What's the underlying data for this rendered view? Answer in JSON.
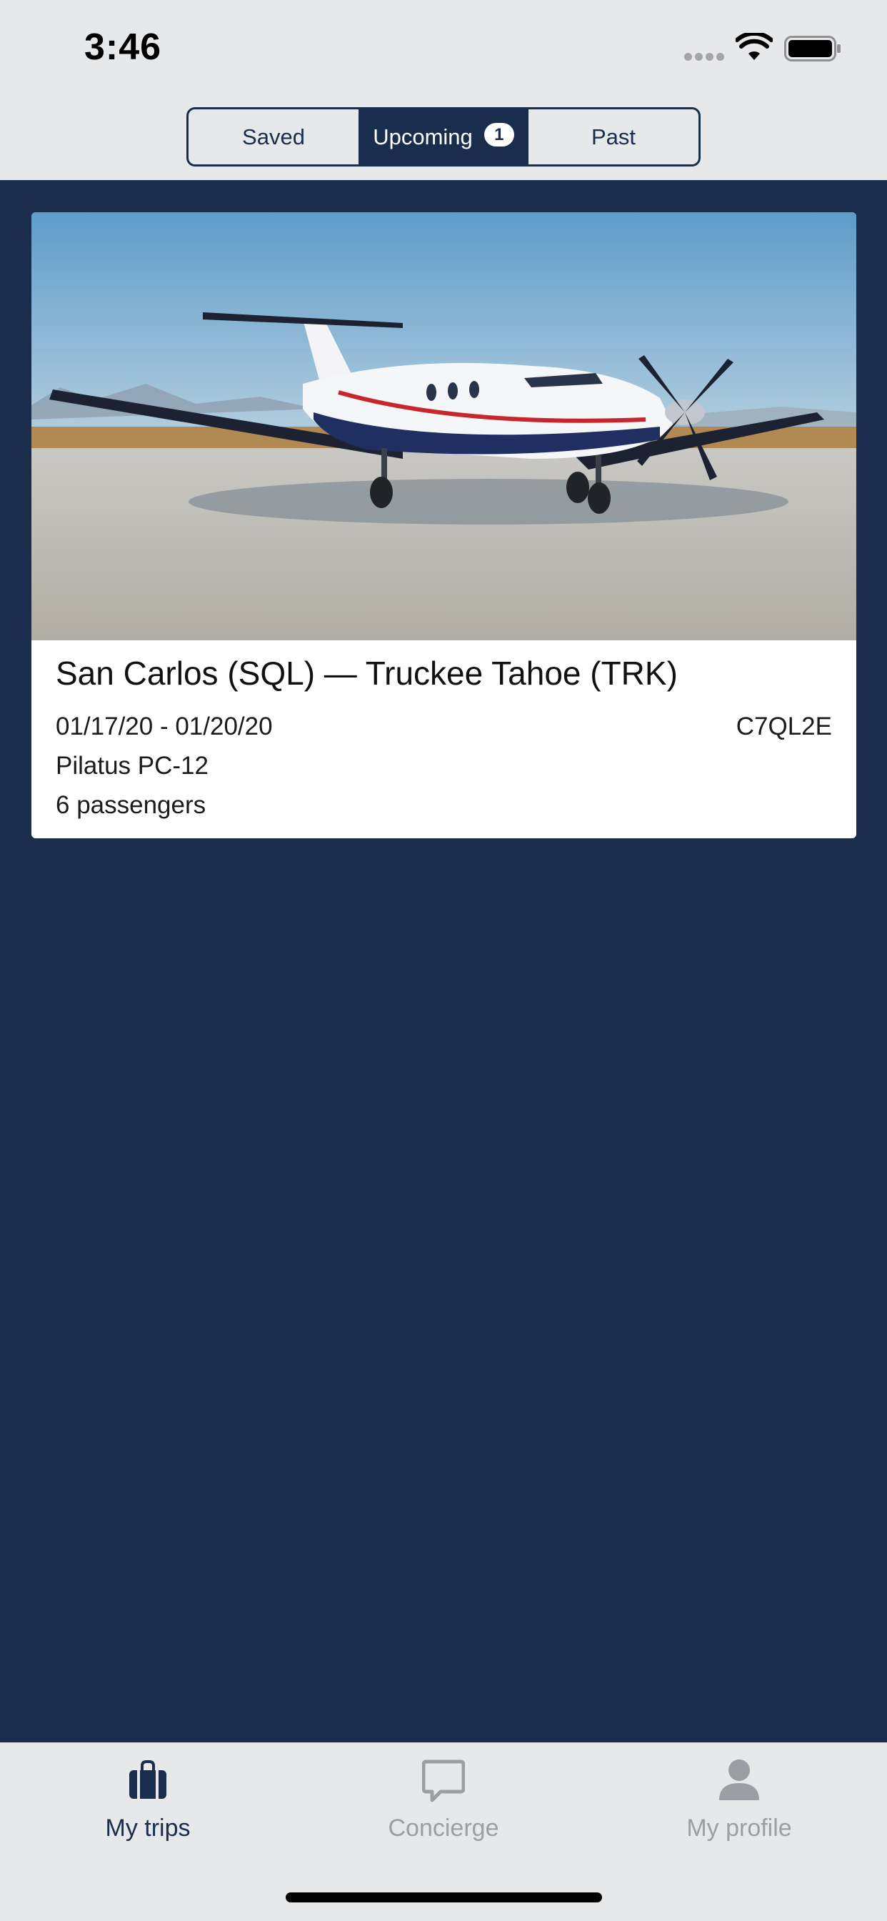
{
  "status_bar": {
    "time": "3:46",
    "icons": [
      "cellular-signal-icon",
      "wifi-icon",
      "battery-icon"
    ]
  },
  "segments": [
    {
      "label": "Saved",
      "active": false
    },
    {
      "label": "Upcoming",
      "active": true,
      "badge": "1"
    },
    {
      "label": "Past",
      "active": false
    }
  ],
  "trip": {
    "route": "San Carlos (SQL) — Truckee Tahoe (TRK)",
    "dates": "01/17/20 - 01/20/20",
    "code": "C7QL2E",
    "aircraft": "Pilatus PC-12",
    "passengers": "6 passengers",
    "photo_icon": "aircraft-photo"
  },
  "tabs": [
    {
      "label": "My trips",
      "icon": "briefcase-icon",
      "active": true
    },
    {
      "label": "Concierge",
      "icon": "chat-bubble-icon",
      "active": false
    },
    {
      "label": "My profile",
      "icon": "person-icon",
      "active": false
    }
  ],
  "colors": {
    "navy": "#1b2d4d",
    "chrome_gray": "#e7e8ea",
    "inactive_gray": "#9b9ea3",
    "card_white": "#ffffff"
  }
}
